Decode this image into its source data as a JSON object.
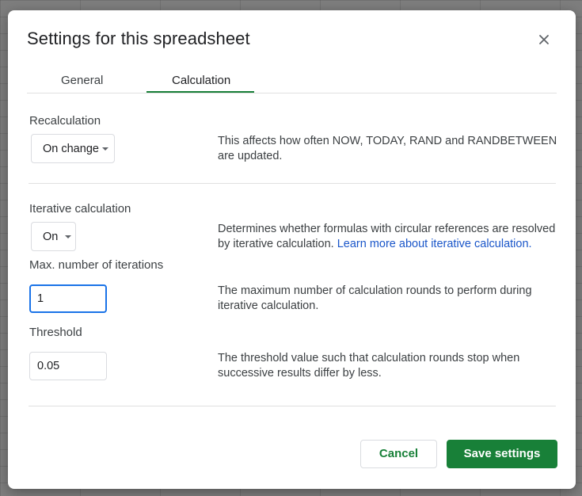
{
  "dialog": {
    "title": "Settings for this spreadsheet",
    "close_icon": "close-icon"
  },
  "tabs": [
    {
      "label": "General",
      "active": false
    },
    {
      "label": "Calculation",
      "active": true
    }
  ],
  "recalculation": {
    "label": "Recalculation",
    "selected": "On change",
    "description": "This affects how often NOW, TODAY, RAND and RANDBETWEEN are updated."
  },
  "iterative": {
    "label": "Iterative calculation",
    "selected": "On",
    "description": "Determines whether formulas with circular references are resolved by iterative calculation.",
    "link_text": "Learn more about iterative calculation."
  },
  "max_iterations": {
    "label": "Max. number of iterations",
    "value": "1",
    "description": "The maximum number of calculation rounds to perform during iterative calculation."
  },
  "threshold": {
    "label": "Threshold",
    "value": "0.05",
    "description": "The threshold value such that calculation rounds stop when successive results differ by less."
  },
  "buttons": {
    "cancel": "Cancel",
    "save": "Save settings"
  },
  "colors": {
    "accent_green": "#188038",
    "focus_blue": "#1a73e8",
    "link_blue": "#1a56c9"
  }
}
